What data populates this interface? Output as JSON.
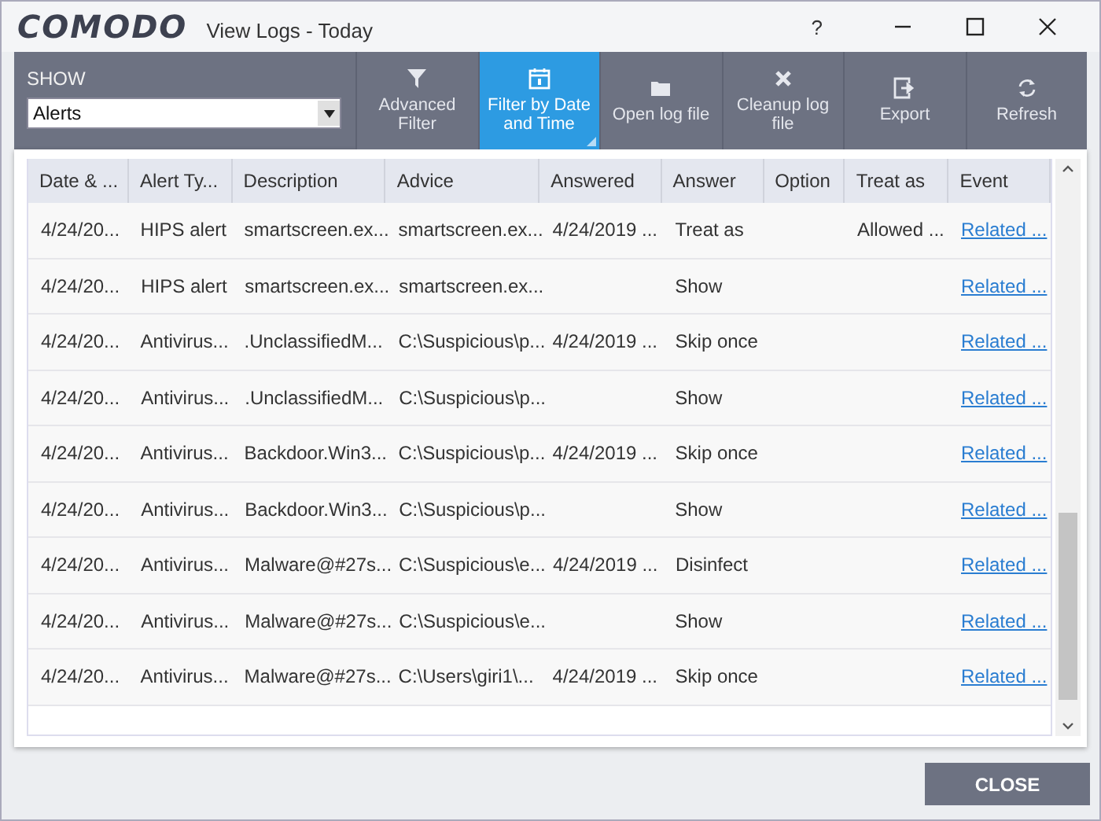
{
  "window": {
    "logo": "COMODO",
    "title": "View Logs - Today",
    "help": "?"
  },
  "show": {
    "label": "SHOW",
    "value": "Alerts"
  },
  "toolbar": [
    {
      "kind": "funnel",
      "label": "Advanced Filter",
      "selected": false
    },
    {
      "kind": "calendar",
      "label": "Filter by Date and Time",
      "selected": true
    },
    {
      "kind": "folder",
      "label": "Open log file",
      "selected": false
    },
    {
      "kind": "cross",
      "label": "Cleanup log file",
      "selected": false
    },
    {
      "kind": "export",
      "label": "Export",
      "selected": false
    },
    {
      "kind": "refresh",
      "label": "Refresh",
      "selected": false
    }
  ],
  "table": {
    "columns": [
      "Date & ...",
      "Alert Ty...",
      "Description",
      "Advice",
      "Answered",
      "Answer",
      "Option",
      "Treat as",
      "Event"
    ],
    "rows": [
      {
        "cells": [
          "4/24/20...",
          "HIPS alert",
          "smartscreen.ex...",
          "smartscreen.ex...",
          "4/24/2019 ...",
          "Treat as",
          "",
          "Allowed ...",
          "Related ..."
        ]
      },
      {
        "cells": [
          "4/24/20...",
          "HIPS alert",
          "smartscreen.ex...",
          "smartscreen.ex...",
          "",
          "Show",
          "",
          "",
          "Related ..."
        ]
      },
      {
        "cells": [
          "4/24/20...",
          "Antivirus...",
          ".UnclassifiedM...",
          "C:\\Suspicious\\p...",
          "4/24/2019 ...",
          "Skip once",
          "",
          "",
          "Related ..."
        ]
      },
      {
        "cells": [
          "4/24/20...",
          "Antivirus...",
          ".UnclassifiedM...",
          "C:\\Suspicious\\p...",
          "",
          "Show",
          "",
          "",
          "Related ..."
        ]
      },
      {
        "cells": [
          "4/24/20...",
          "Antivirus...",
          "Backdoor.Win3...",
          "C:\\Suspicious\\p...",
          "4/24/2019 ...",
          "Skip once",
          "",
          "",
          "Related ..."
        ]
      },
      {
        "cells": [
          "4/24/20...",
          "Antivirus...",
          "Backdoor.Win3...",
          "C:\\Suspicious\\p...",
          "",
          "Show",
          "",
          "",
          "Related ..."
        ]
      },
      {
        "cells": [
          "4/24/20...",
          "Antivirus...",
          "Malware@#27s...",
          "C:\\Suspicious\\e...",
          "4/24/2019 ...",
          "Disinfect",
          "",
          "",
          "Related ..."
        ]
      },
      {
        "cells": [
          "4/24/20...",
          "Antivirus...",
          "Malware@#27s...",
          "C:\\Suspicious\\e...",
          "",
          "Show",
          "",
          "",
          "Related ..."
        ]
      },
      {
        "cells": [
          "4/24/20...",
          "Antivirus...",
          "Malware@#27s...",
          "C:\\Users\\giri1\\...",
          "4/24/2019 ...",
          "Skip once",
          "",
          "",
          "Related ..."
        ]
      }
    ]
  },
  "close_button": "CLOSE"
}
